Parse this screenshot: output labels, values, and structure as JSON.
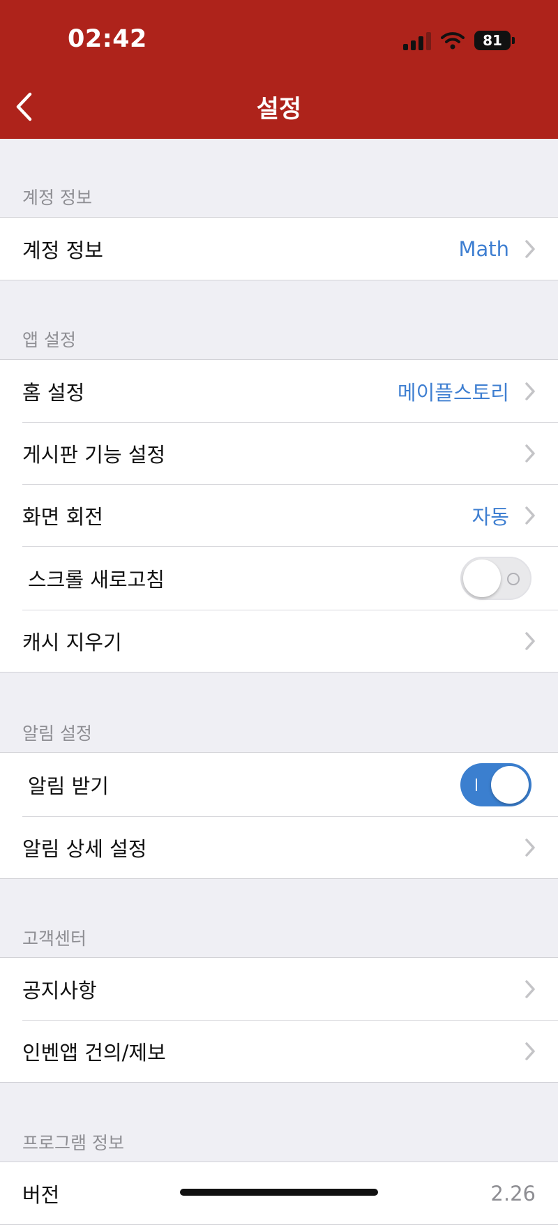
{
  "status": {
    "time": "02:42",
    "battery": "81"
  },
  "nav": {
    "title": "설정"
  },
  "sections": {
    "account": {
      "header": "계정 정보",
      "rows": {
        "account": {
          "label": "계정 정보",
          "value": "Math"
        }
      }
    },
    "app": {
      "header": "앱 설정",
      "rows": {
        "home": {
          "label": "홈 설정",
          "value": "메이플스토리"
        },
        "board": {
          "label": "게시판 기능 설정"
        },
        "rotation": {
          "label": "화면 회전",
          "value": "자동"
        },
        "scroll_refresh": {
          "label": "스크롤 새로고침",
          "toggle": "off"
        },
        "clear_cache": {
          "label": "캐시 지우기"
        }
      }
    },
    "notifications": {
      "header": "알림 설정",
      "rows": {
        "receive": {
          "label": "알림 받기",
          "toggle": "on"
        },
        "detail": {
          "label": "알림 상세 설정"
        }
      }
    },
    "support": {
      "header": "고객센터",
      "rows": {
        "notice": {
          "label": "공지사항"
        },
        "feedback": {
          "label": "인벤앱 건의/제보"
        }
      }
    },
    "program": {
      "header": "프로그램 정보",
      "rows": {
        "version": {
          "label": "버전",
          "value": "2.26"
        }
      }
    }
  },
  "colors": {
    "header_bg": "#ae231b",
    "accent": "#3b7fcf",
    "value_text": "#3f7fd1"
  }
}
